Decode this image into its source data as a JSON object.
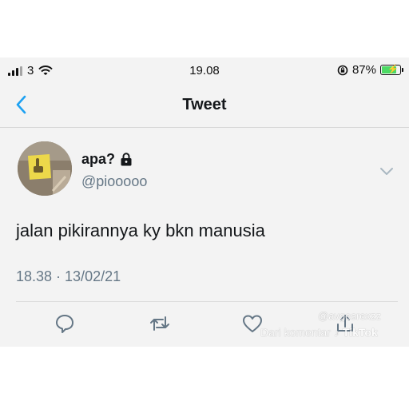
{
  "status_bar": {
    "carrier": "3",
    "time": "19.08",
    "battery_percent": "87%",
    "battery_level": 0.87,
    "icons": [
      "signal-bars-icon",
      "wifi-icon",
      "orientation-lock-icon",
      "battery-charging-icon"
    ]
  },
  "nav": {
    "title": "Tweet",
    "back_icon": "chevron-left-icon"
  },
  "tweet": {
    "name": "apa?",
    "handle": "@piooooo",
    "text": "jalan pikirannya ky bkn manusia",
    "timestamp": "18.38 · 13/02/21",
    "actions": [
      "reply-icon",
      "retweet-icon",
      "like-icon",
      "share-icon"
    ]
  },
  "watermark": {
    "user": "@avgesrexzz",
    "source": "Dari komentar",
    "brand": "TikTok"
  },
  "colors": {
    "accent": "#1da1f2",
    "secondary_text": "#657786",
    "battery_fill": "#4cd964"
  }
}
